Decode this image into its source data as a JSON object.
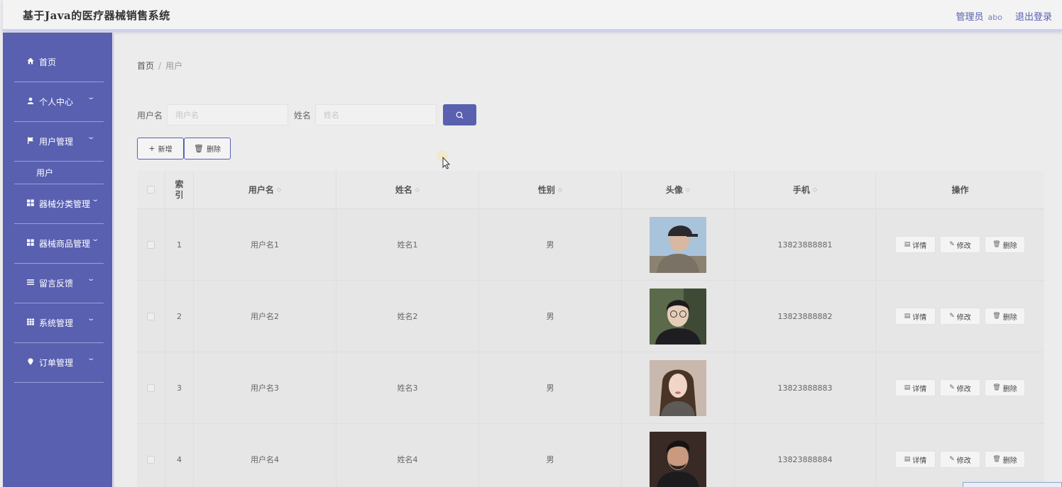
{
  "header": {
    "app_title": "基于Java的医疗器械销售系统",
    "role": "管理员",
    "username": "abo",
    "logout": "退出登录"
  },
  "sidebar": {
    "items": [
      {
        "label": "首页",
        "icon": "home-icon"
      },
      {
        "label": "个人中心",
        "icon": "user-icon"
      },
      {
        "label": "用户管理",
        "icon": "flag-icon"
      },
      {
        "label": "器械分类管理",
        "icon": "grid-icon"
      },
      {
        "label": "器械商品管理",
        "icon": "grid-icon"
      },
      {
        "label": "留言反馈",
        "icon": "list-icon"
      },
      {
        "label": "系统管理",
        "icon": "grid-icon"
      },
      {
        "label": "订单管理",
        "icon": "pin-icon"
      }
    ],
    "sub_item": "用户"
  },
  "breadcrumb": {
    "home": "首页",
    "sep": "/",
    "current": "用户"
  },
  "search": {
    "username_label": "用户名",
    "username_placeholder": "用户名",
    "name_label": "姓名",
    "name_placeholder": "姓名"
  },
  "toolbar": {
    "add_label": "新增",
    "delete_label": "删除"
  },
  "table": {
    "headers": {
      "index": "索引",
      "username": "用户名",
      "name": "姓名",
      "sex": "性别",
      "avatar": "头像",
      "phone": "手机",
      "actions": "操作"
    },
    "rows": [
      {
        "index": "1",
        "username": "用户名1",
        "name": "姓名1",
        "sex": "男",
        "phone": "13823888881"
      },
      {
        "index": "2",
        "username": "用户名2",
        "name": "姓名2",
        "sex": "男",
        "phone": "13823888882"
      },
      {
        "index": "3",
        "username": "用户名3",
        "name": "姓名3",
        "sex": "男",
        "phone": "13823888883"
      },
      {
        "index": "4",
        "username": "用户名4",
        "name": "姓名4",
        "sex": "男",
        "phone": "13823888884"
      }
    ],
    "row_actions": {
      "detail": "详情",
      "edit": "修改",
      "delete": "删除"
    }
  },
  "colors": {
    "accent": "#5960b0",
    "background": "#ececec"
  }
}
